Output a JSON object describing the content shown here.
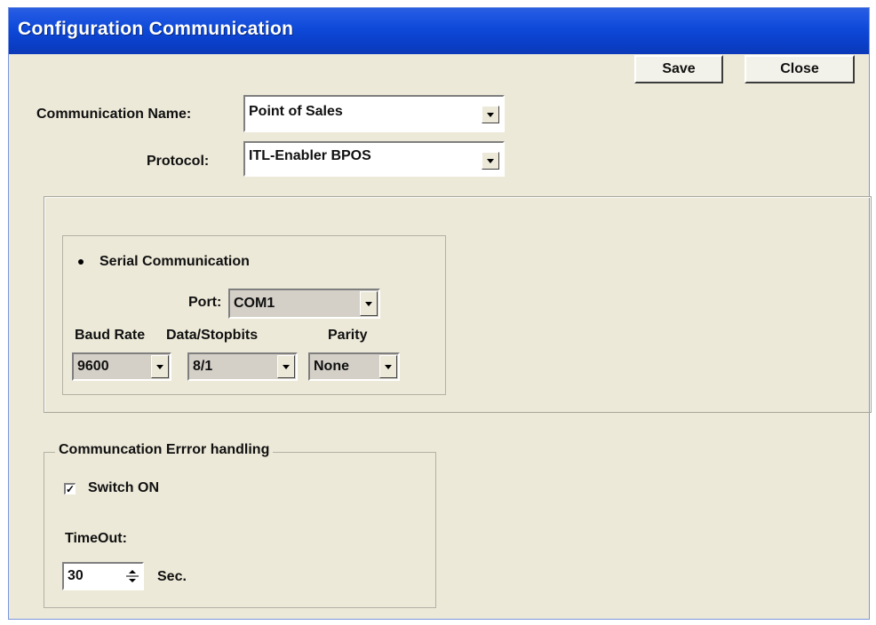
{
  "window": {
    "title": "Configuration Communication"
  },
  "toolbar": {
    "save_label": "Save",
    "close_label": "Close"
  },
  "form": {
    "communication_name": {
      "label": "Communication Name:",
      "value": "Point of Sales"
    },
    "protocol": {
      "label": "Protocol:",
      "value": "ITL-Enabler BPOS"
    }
  },
  "serial": {
    "radio_label": "Serial Communication",
    "port": {
      "label": "Port:",
      "value": "COM1"
    },
    "baud_rate": {
      "label": "Baud Rate",
      "value": "9600"
    },
    "data_stopbits": {
      "label": "Data/Stopbits",
      "value": "8/1"
    },
    "parity": {
      "label": "Parity",
      "value": "None"
    }
  },
  "error_handling": {
    "legend": "Communcation Errror handling",
    "switch_label": "Switch ON",
    "switch_checked": true,
    "timeout_label": "TimeOut:",
    "timeout_value": "30",
    "timeout_unit": "Sec."
  },
  "colors": {
    "titlebar": "#0a3fc9",
    "dialog_bg": "#ece9d8"
  },
  "icons": {
    "dropdown": "chevron-down-icon",
    "radio": "radio-selected-icon",
    "check": "checkmark-icon",
    "spinner": "spinner-arrows-icon"
  }
}
